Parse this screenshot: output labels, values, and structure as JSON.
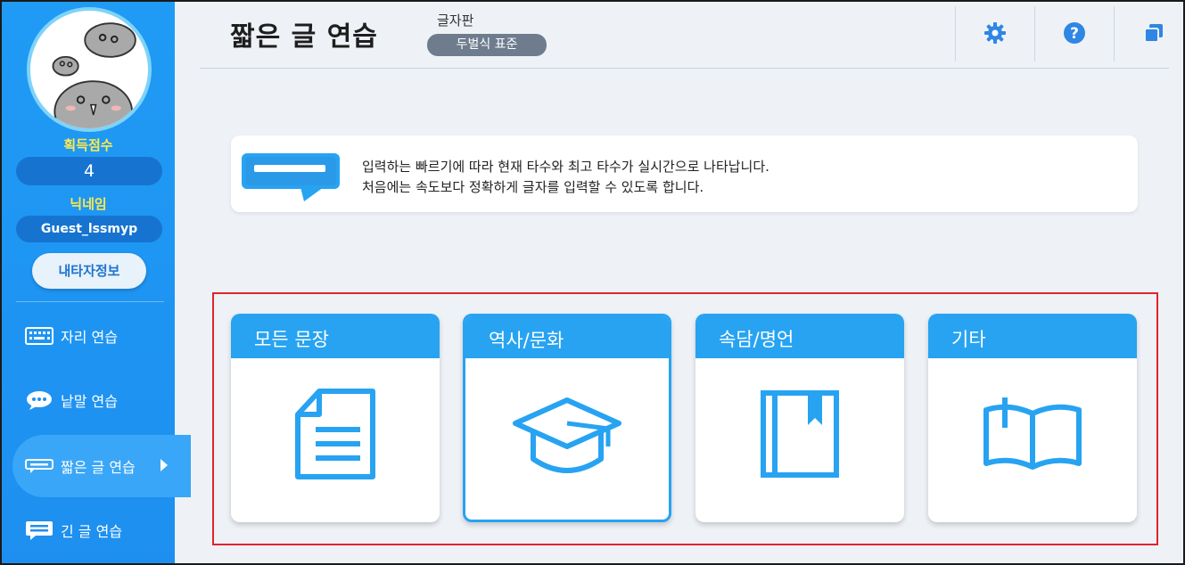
{
  "sidebar": {
    "score_label": "획득점수",
    "score_value": "4",
    "nickname_label": "닉네임",
    "nickname_value": "Guest_lssmyp",
    "my_info_button": "내타자정보",
    "items": [
      {
        "label": "자리 연습",
        "icon": "keyboard-icon"
      },
      {
        "label": "낱말 연습",
        "icon": "speech-bubble-icon"
      },
      {
        "label": "짧은 글 연습",
        "icon": "short-text-icon",
        "active": true
      },
      {
        "label": "긴 글 연습",
        "icon": "long-text-icon"
      }
    ]
  },
  "header": {
    "title": "짧은 글 연습",
    "layout_label": "글자판",
    "layout_value": "두벌식 표준",
    "icons": [
      "gear-icon",
      "help-icon",
      "window-icon"
    ]
  },
  "info": {
    "line1": "입력하는 빠르기에 따라 현재 타수와 최고 타수가 실시간으로 나타납니다.",
    "line2": "처음에는 속도보다 정확하게 글자를 입력할 수 있도록 합니다."
  },
  "cards": [
    {
      "label": "모든 문장",
      "icon": "document-icon"
    },
    {
      "label": "역사/문화",
      "icon": "graduation-cap-icon",
      "selected": true
    },
    {
      "label": "속담/명언",
      "icon": "bookmark-book-icon"
    },
    {
      "label": "기타",
      "icon": "open-book-icon"
    }
  ],
  "colors": {
    "sidebar": "#1e8ff0",
    "accent": "#27a3f2",
    "highlight": "#e0232e",
    "score_text": "#ffe94a"
  }
}
